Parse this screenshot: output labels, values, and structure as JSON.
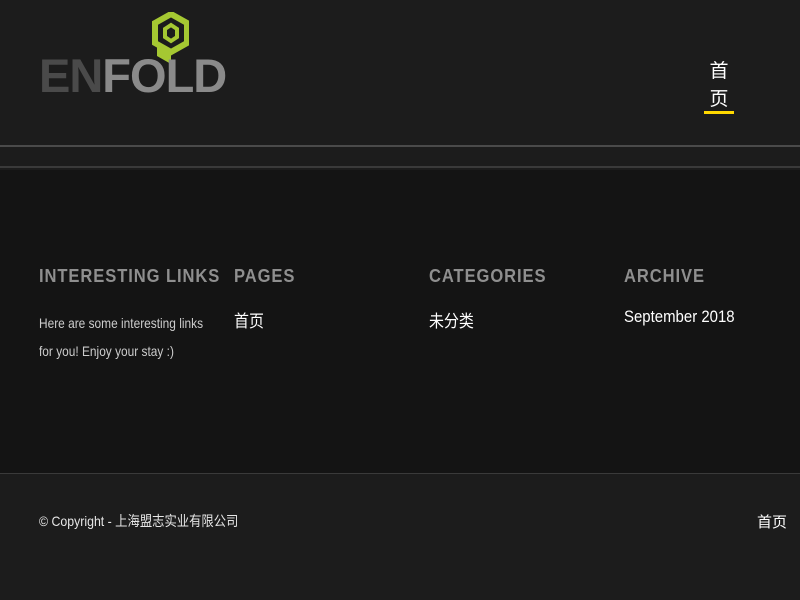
{
  "logo": {
    "part1": "EN",
    "part2": "FOLD",
    "icon": "hexagon-logo-icon"
  },
  "header": {
    "nav_home": "首页"
  },
  "colors": {
    "accent_underline": "#ffd800",
    "logo_green": "#a5c832",
    "footer_bg": "#141414",
    "header_bg": "#1c1c1c"
  },
  "footer": {
    "columns": [
      {
        "title": "INTERESTING LINKS",
        "text": "Here are some interesting links for you! Enjoy your stay :)"
      },
      {
        "title": "PAGES",
        "link": "首页"
      },
      {
        "title": "CATEGORIES",
        "link": "未分类"
      },
      {
        "title": "ARCHIVE",
        "link": "September 2018"
      }
    ]
  },
  "socket": {
    "copyright": "© Copyright - 上海盟志实业有限公司",
    "nav_home": "首页"
  }
}
